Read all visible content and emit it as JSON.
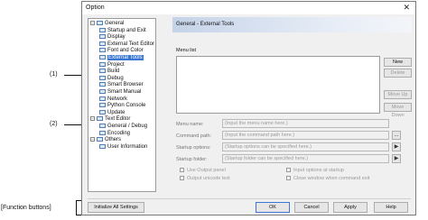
{
  "window": {
    "title": "Option",
    "close_glyph": "✕"
  },
  "tree": [
    {
      "label": "General",
      "level": 0,
      "expander": "−"
    },
    {
      "label": "Startup and Exit",
      "level": 1
    },
    {
      "label": "Display",
      "level": 1
    },
    {
      "label": "External Text Editor",
      "level": 1
    },
    {
      "label": "Font and Color",
      "level": 1
    },
    {
      "label": "External Tools",
      "level": 1,
      "selected": true
    },
    {
      "label": "Project",
      "level": 1
    },
    {
      "label": "Build",
      "level": 1
    },
    {
      "label": "Debug",
      "level": 1
    },
    {
      "label": "Smart Browser",
      "level": 1
    },
    {
      "label": "Smart Manual",
      "level": 1
    },
    {
      "label": "Network",
      "level": 1
    },
    {
      "label": "Python Console",
      "level": 1
    },
    {
      "label": "Update",
      "level": 1
    },
    {
      "label": "Text Editor",
      "level": 0,
      "expander": "−"
    },
    {
      "label": "General / Debug",
      "level": 1
    },
    {
      "label": "Encoding",
      "level": 1
    },
    {
      "label": "Others",
      "level": 0,
      "expander": "−"
    },
    {
      "label": "User Information",
      "level": 1
    }
  ],
  "panel": {
    "header": "General - External Tools",
    "menu_list_label": "Menu list",
    "buttons": {
      "new": "New",
      "delete": "Delete",
      "move_up": "Move Up",
      "move_down": "Move Down"
    },
    "fields": {
      "menu_name_label": "Menu name:",
      "menu_name_placeholder": "(Input the menu name here.)",
      "command_path_label": "Command path:",
      "command_path_placeholder": "(Input the command path here.)",
      "browse_label": "...",
      "startup_options_label": "Startup options:",
      "startup_options_placeholder": "(Startup options can be specified here.)",
      "startup_folder_label": "Startup folder:",
      "startup_folder_placeholder": "(Startup folder can be specified here.)",
      "arrow_glyph": "▶"
    },
    "checkboxes": {
      "use_output_panel": "Use Output panel",
      "output_unicode": "Output unicode text",
      "input_options_startup": "Input options at startup",
      "close_window": "Close window when command exit"
    }
  },
  "footer": {
    "initialize": "Initialize All Settings",
    "ok": "OK",
    "cancel": "Cancel",
    "apply": "Apply",
    "help": "Help"
  },
  "annotations": {
    "callout_1": "(1)",
    "callout_2": "(2)",
    "function_buttons": "[Function buttons]"
  }
}
